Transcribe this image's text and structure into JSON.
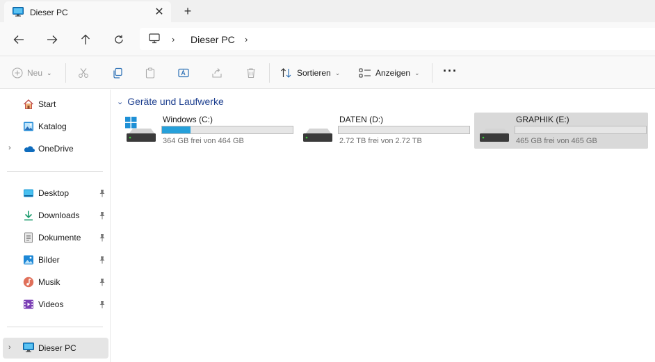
{
  "tab": {
    "title": "Dieser PC",
    "close_glyph": "✕",
    "new_glyph": "+"
  },
  "address": {
    "crumb": "Dieser PC",
    "separator": "›"
  },
  "toolbar": {
    "new_label": "Neu",
    "sort_label": "Sortieren",
    "view_label": "Anzeigen",
    "more_glyph": "···"
  },
  "sidebar": {
    "quick": [
      {
        "label": "Start",
        "icon": "home-icon"
      },
      {
        "label": "Katalog",
        "icon": "gallery-icon"
      },
      {
        "label": "OneDrive",
        "icon": "onedrive-icon"
      }
    ],
    "pinned": [
      {
        "label": "Desktop",
        "icon": "desktop-icon"
      },
      {
        "label": "Downloads",
        "icon": "download-icon"
      },
      {
        "label": "Dokumente",
        "icon": "documents-icon"
      },
      {
        "label": "Bilder",
        "icon": "pictures-icon"
      },
      {
        "label": "Musik",
        "icon": "music-icon"
      },
      {
        "label": "Videos",
        "icon": "videos-icon"
      }
    ],
    "this_pc": {
      "label": "Dieser PC",
      "icon": "pc-icon"
    }
  },
  "main": {
    "group_title": "Geräte und Laufwerke",
    "drives": [
      {
        "name": "Windows (C:)",
        "free_text": "364 GB frei von 464 GB",
        "used_fraction": 0.22
      },
      {
        "name": "DATEN (D:)",
        "free_text": "2.72 TB frei von 2.72 TB",
        "used_fraction": 0.0
      },
      {
        "name": "GRAPHIK (E:)",
        "free_text": "465 GB frei von 465 GB",
        "used_fraction": 0.0
      }
    ]
  },
  "colors": {
    "accent": "#26a0da",
    "group_header": "#1d3f8f",
    "selected": "#d9d9d9"
  }
}
